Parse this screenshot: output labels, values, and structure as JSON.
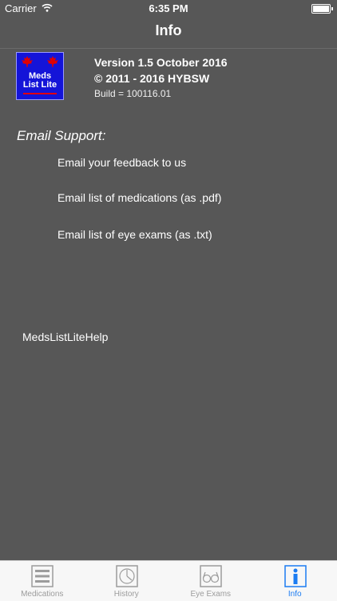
{
  "status_bar": {
    "carrier": "Carrier",
    "time": "6:35 PM"
  },
  "nav": {
    "title": "Info"
  },
  "app_icon": {
    "line1": "Meds",
    "line2": "List Lite"
  },
  "about": {
    "version": "Version 1.5 October 2016",
    "copyright": "© 2011 - 2016 HYBSW",
    "build": "Build = 100116.01"
  },
  "email_support": {
    "heading": "Email Support:",
    "items": [
      "Email your feedback to us",
      "Email list of medications (as .pdf)",
      "Email list of eye exams (as .txt)"
    ]
  },
  "help": {
    "label": "MedsListLiteHelp"
  },
  "tab_bar": {
    "tabs": [
      {
        "label": "Medications",
        "icon": "list-icon"
      },
      {
        "label": "History",
        "icon": "clock-icon"
      },
      {
        "label": "Eye Exams",
        "icon": "glasses-icon"
      },
      {
        "label": "Info",
        "icon": "info-icon"
      }
    ],
    "active_index": 3
  },
  "colors": {
    "background": "#575757",
    "icon_blue": "#1414d8",
    "leaf_red": "#e00000",
    "tab_active": "#1b7cf2",
    "tab_inactive": "#9c9c9c"
  }
}
